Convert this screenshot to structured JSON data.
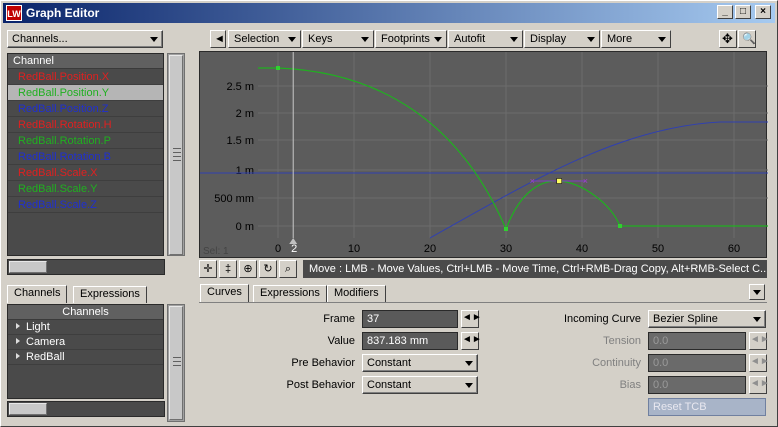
{
  "window": {
    "title": "Graph Editor",
    "minimize": "_",
    "maximize": "□",
    "close": "×"
  },
  "left": {
    "channels_dropdown": "Channels...",
    "channel_header": "Channel",
    "channels": [
      {
        "label": "RedBall.Position.X",
        "color": "#e02020"
      },
      {
        "label": "RedBall.Position.Y",
        "color": "#20b020"
      },
      {
        "label": "RedBall.Position.Z",
        "color": "#2030d0"
      },
      {
        "label": "RedBall.Rotation.H",
        "color": "#e02020"
      },
      {
        "label": "RedBall.Rotation.P",
        "color": "#20b020"
      },
      {
        "label": "RedBall.Rotation.B",
        "color": "#2030d0"
      },
      {
        "label": "RedBall.Scale.X",
        "color": "#e02020"
      },
      {
        "label": "RedBall.Scale.Y",
        "color": "#20b020"
      },
      {
        "label": "RedBall.Scale.Z",
        "color": "#2030d0"
      }
    ],
    "selected_channel": 1,
    "tabs": [
      "Channels",
      "Expressions"
    ],
    "tree_header": "Channels",
    "tree": [
      "Light",
      "Camera",
      "RedBall"
    ]
  },
  "toolbar": {
    "back_icon": "◄",
    "menus": [
      "Selection",
      "Keys",
      "Footprints",
      "Autofit",
      "Display",
      "More"
    ]
  },
  "graph": {
    "y_ticks": [
      "2.5 m",
      "2 m",
      "1.5 m",
      "1 m",
      "500 mm",
      "0 m"
    ],
    "x_ticks": [
      "0",
      "10",
      "20",
      "30",
      "40",
      "50",
      "60"
    ],
    "sel_label": "Sel: 1",
    "current_frame_label": "2"
  },
  "status": {
    "mode": "Move",
    "hint": ":  LMB - Move Values, Ctrl+LMB - Move Time, Ctrl+RMB-Drag Copy, Alt+RMB-Select C..."
  },
  "bottom_tabs": [
    "Curves",
    "Expressions",
    "Modifiers"
  ],
  "props": {
    "frame_label": "Frame",
    "frame_value": "37",
    "value_label": "Value",
    "value_value": "837.183 mm",
    "pre_label": "Pre Behavior",
    "pre_value": "Constant",
    "post_label": "Post Behavior",
    "post_value": "Constant",
    "incoming_label": "Incoming Curve",
    "incoming_value": "Bezier Spline",
    "tension_label": "Tension",
    "tension_value": "0.0",
    "continuity_label": "Continuity",
    "continuity_value": "0.0",
    "bias_label": "Bias",
    "bias_value": "0.0",
    "reset_label": "Reset TCB"
  }
}
